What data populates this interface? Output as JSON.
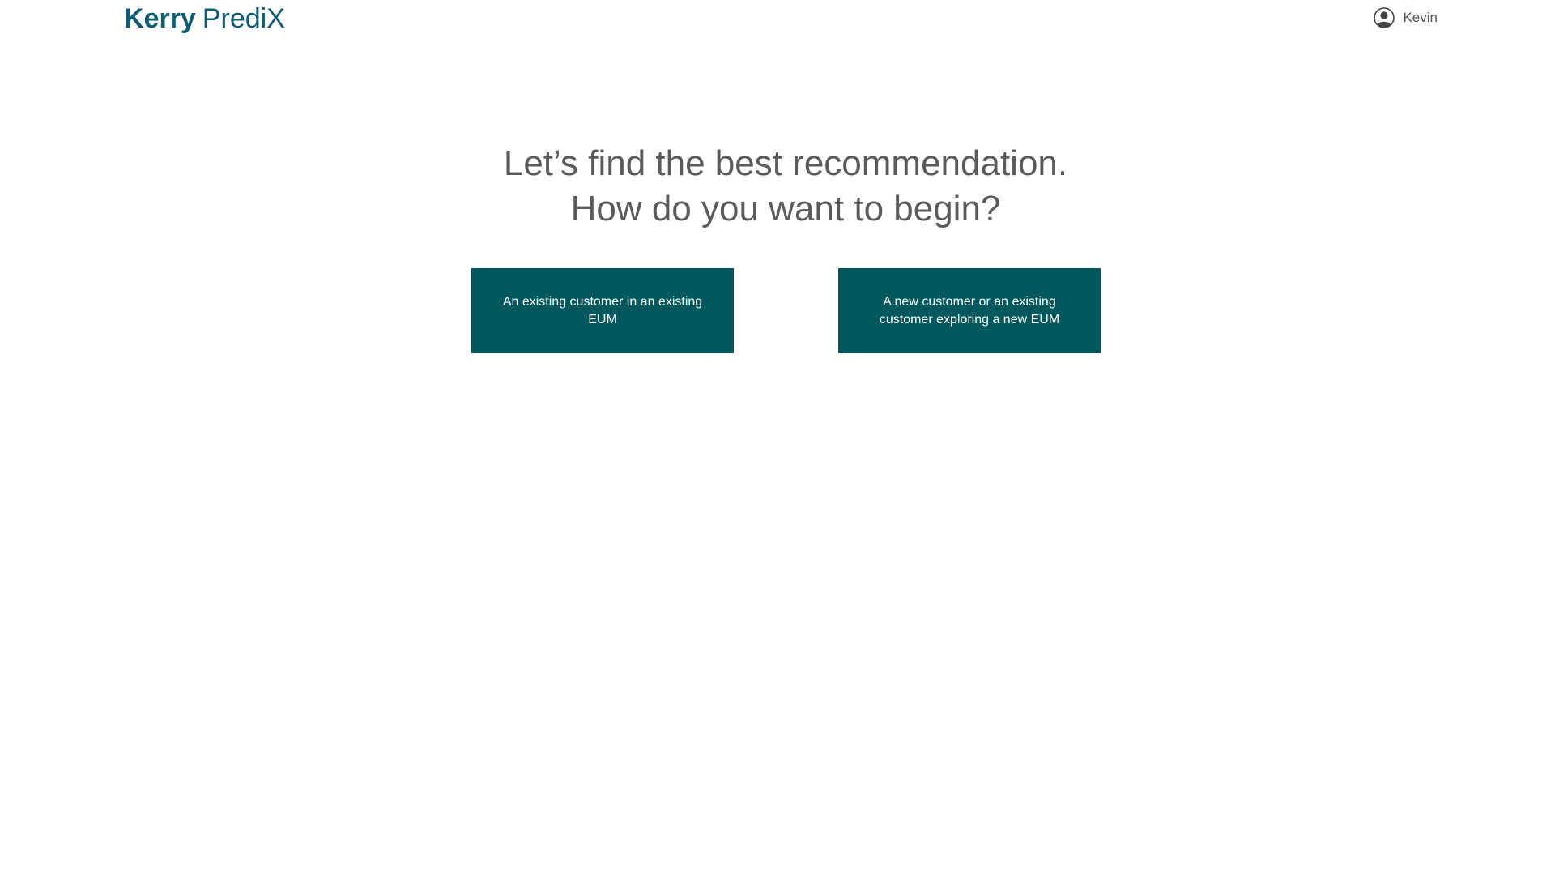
{
  "header": {
    "brand": "Kerry",
    "product": "PrediX",
    "user_name": "Kevin",
    "user_icon": "user-circle-icon"
  },
  "main": {
    "headline_line1": "Let’s find the best recommendation.",
    "headline_line2": "How do you want to begin?",
    "options": [
      {
        "label": "An existing customer in an existing EUM"
      },
      {
        "label": "A new customer or an existing customer exploring a new EUM"
      }
    ]
  },
  "colors": {
    "brand": "#0d5c75",
    "button_bg": "#01595e",
    "button_text": "#ffffff",
    "headline": "#5a5a5a"
  }
}
